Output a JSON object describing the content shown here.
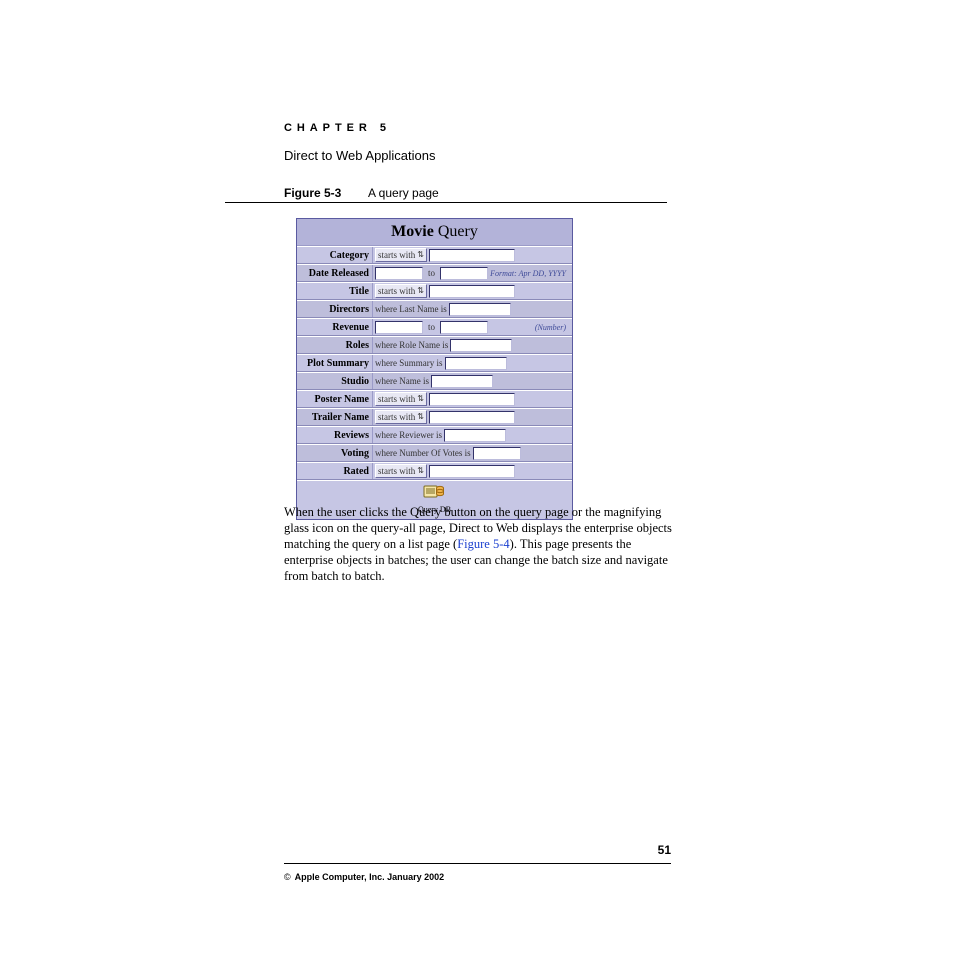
{
  "header": {
    "chapter": "CHAPTER 5",
    "section_title": "Direct to Web Applications"
  },
  "figure": {
    "label": "Figure 5-3",
    "caption": "A query page"
  },
  "panel": {
    "title_strong": "Movie",
    "title_rest": " Query",
    "rows": [
      {
        "label": "Category",
        "type": "select_text",
        "select": "starts with",
        "text_w": "long"
      },
      {
        "label": "Date Released",
        "type": "range_hint",
        "hint": "Format: Apr DD, YYYY"
      },
      {
        "label": "Title",
        "type": "select_text",
        "select": "starts with",
        "text_w": "long"
      },
      {
        "label": "Directors",
        "type": "desc_text",
        "desc": "where Last Name is",
        "text_w": "med"
      },
      {
        "label": "Revenue",
        "type": "range_hint",
        "hint": "(Number)"
      },
      {
        "label": "Roles",
        "type": "desc_text",
        "desc": "where Role Name is",
        "text_w": "med"
      },
      {
        "label": "Plot Summary",
        "type": "desc_text",
        "desc": "where Summary is",
        "text_w": "med"
      },
      {
        "label": "Studio",
        "type": "desc_text",
        "desc": "where Name is",
        "text_w": "med"
      },
      {
        "label": "Poster Name",
        "type": "select_text",
        "select": "starts with",
        "text_w": "long"
      },
      {
        "label": "Trailer Name",
        "type": "select_text",
        "select": "starts with",
        "text_w": "long"
      },
      {
        "label": "Reviews",
        "type": "desc_text",
        "desc": "where Reviewer is",
        "text_w": "med"
      },
      {
        "label": "Voting",
        "type": "desc_text",
        "desc": "where Number Of Votes is",
        "text_w": "sm"
      },
      {
        "label": "Rated",
        "type": "select_text",
        "select": "starts with",
        "text_w": "long"
      }
    ],
    "to_label": "to",
    "footer_button": "Query DB"
  },
  "body": {
    "p1a": "When the user clicks the Query button on the query page or the magnifying glass icon on the query-all page, Direct to Web displays the enterprise objects matching the query on a list page (",
    "link": "Figure 5-4",
    "p1b": "). This page presents the enterprise objects in batches; the user can change the batch size and navigate from batch to batch."
  },
  "footer": {
    "page_number": "51",
    "copyright_symbol": "©",
    "copyright": "Apple Computer, Inc. January 2002"
  }
}
